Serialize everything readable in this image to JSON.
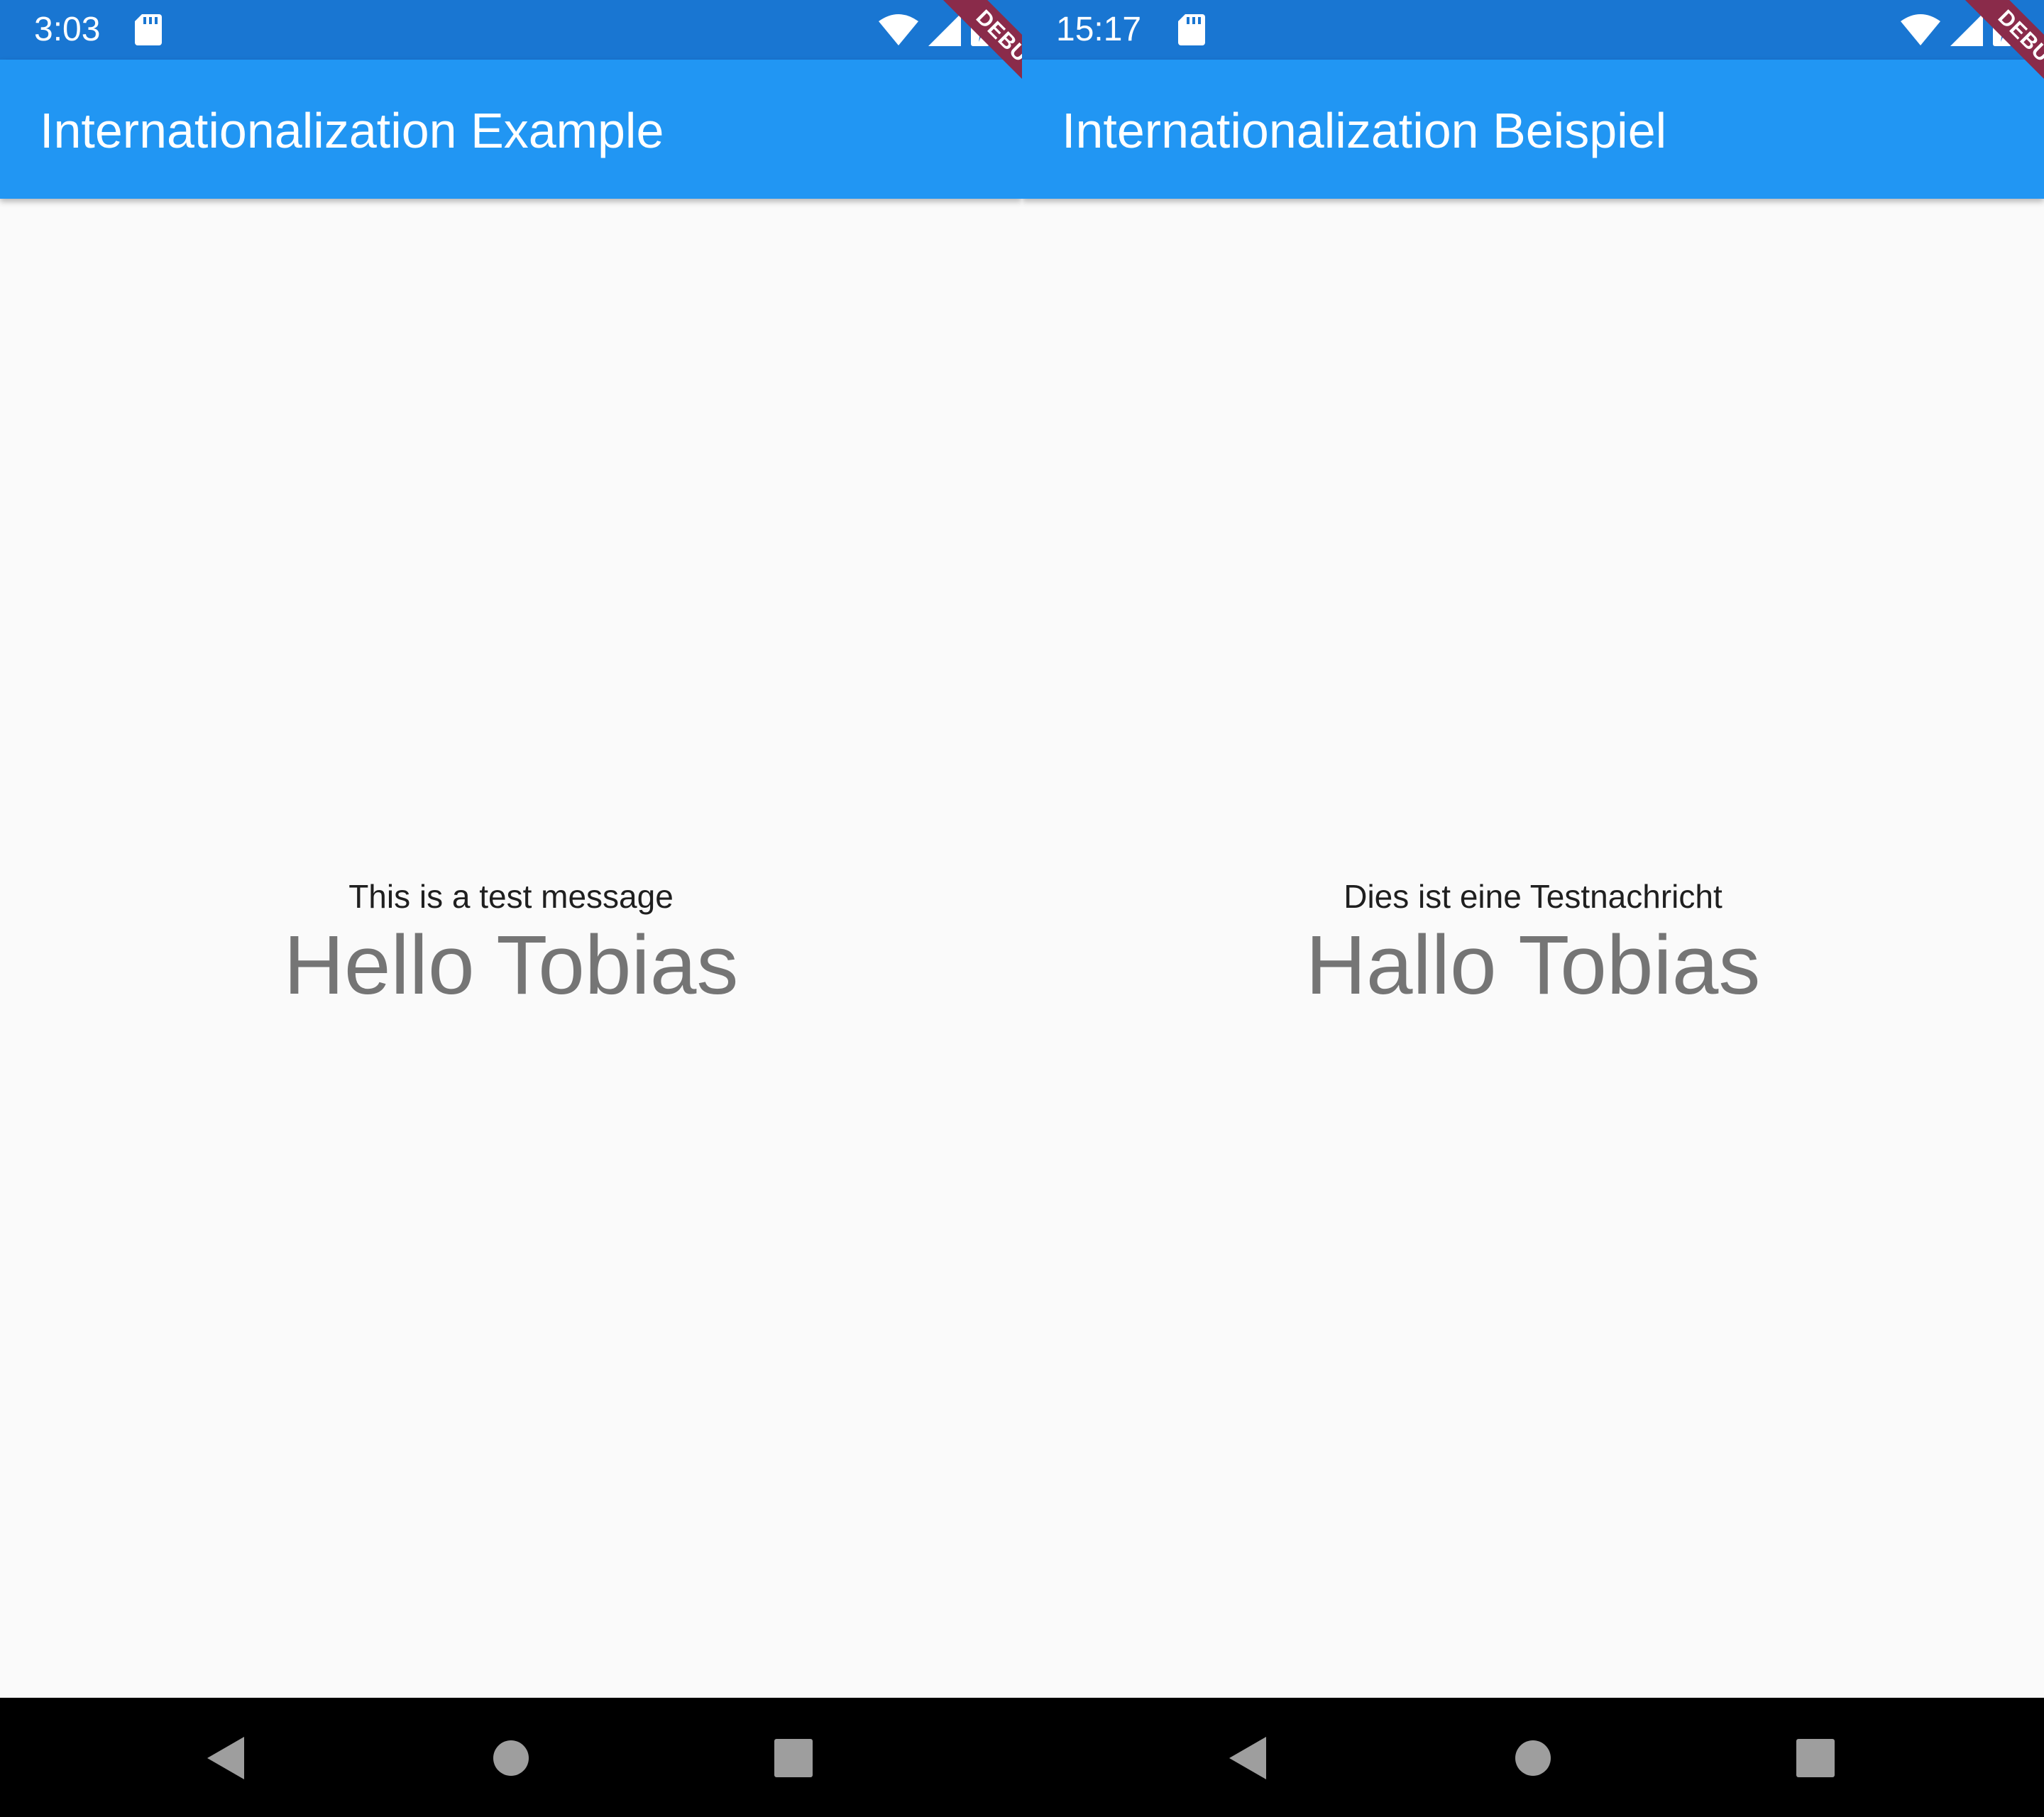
{
  "colors": {
    "status_bar": "#1976d2",
    "app_bar": "#2196f3",
    "background": "#fafafa",
    "greeting_text": "#757575",
    "nav_bar": "#000000",
    "nav_icons": "#9e9e9e",
    "debug_ribbon": "#8a2b4a"
  },
  "screens": [
    {
      "status_bar": {
        "time": "3:03",
        "icons": [
          "sd-card-icon",
          "wifi-icon",
          "signal-icon",
          "battery-charging-icon"
        ]
      },
      "app_bar": {
        "title": "Internationalization Example"
      },
      "debug_banner": "DEBUG",
      "body": {
        "message": "This is a test message",
        "greeting": "Hello Tobias"
      },
      "nav_bar": {
        "icons": [
          "back-icon",
          "home-icon",
          "recents-icon"
        ]
      }
    },
    {
      "status_bar": {
        "time": "15:17",
        "icons": [
          "sd-card-icon",
          "wifi-icon",
          "signal-icon",
          "battery-charging-icon"
        ]
      },
      "app_bar": {
        "title": "Internationalization Beispiel"
      },
      "debug_banner": "DEBUG",
      "body": {
        "message": "Dies ist eine Testnachricht",
        "greeting": "Hallo Tobias"
      },
      "nav_bar": {
        "icons": [
          "back-icon",
          "home-icon",
          "recents-icon"
        ]
      }
    }
  ]
}
